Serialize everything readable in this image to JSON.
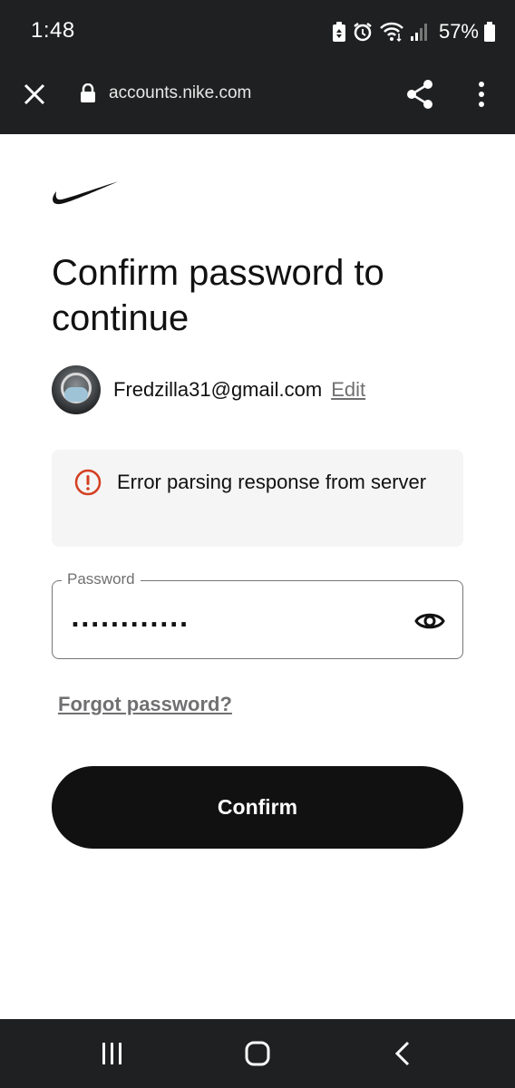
{
  "status_bar": {
    "time": "1:48",
    "battery_percent": "57%",
    "icons": [
      "battery-saver-icon",
      "alarm-icon",
      "wifi-icon",
      "signal-icon",
      "battery-icon"
    ]
  },
  "browser": {
    "url": "accounts.nike.com",
    "icons": [
      "close-icon",
      "lock-icon",
      "share-icon",
      "more-vert-icon"
    ]
  },
  "page": {
    "logo": "nike-swoosh-logo",
    "title": "Confirm password to continue",
    "account": {
      "email": "Fredzilla31@gmail.com",
      "edit_label": "Edit"
    },
    "error": {
      "message": "Error parsing response from server",
      "color": "#d43f21"
    },
    "password": {
      "label": "Password",
      "value": "............"
    },
    "forgot_label": "Forgot password?",
    "confirm_label": "Confirm"
  },
  "nav_bar": {
    "icons": [
      "recent-apps-icon",
      "home-icon",
      "back-icon"
    ]
  },
  "colors": {
    "system_bar": "#1f2021",
    "primary_button": "#111111",
    "error_bg": "#f5f5f5",
    "link_gray": "#707072"
  }
}
